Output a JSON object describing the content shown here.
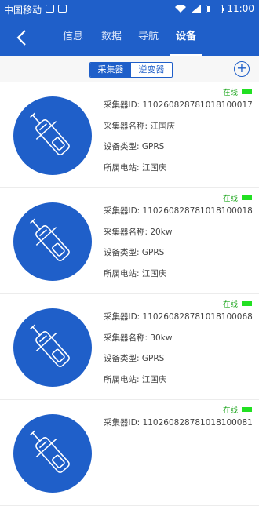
{
  "status": {
    "carrier": "中国移动",
    "time": "11:00",
    "network": "4G"
  },
  "nav": {
    "tabs": [
      {
        "label": "信息"
      },
      {
        "label": "数据"
      },
      {
        "label": "导航"
      },
      {
        "label": "设备",
        "active": true
      }
    ]
  },
  "segment": {
    "left": "采集器",
    "right": "逆变器",
    "selected": "采集器"
  },
  "colors": {
    "primary": "#1f5fc9",
    "online": "#22e022",
    "online_text": "#1aa51a"
  },
  "devices": [
    {
      "status": "在线",
      "id": "采集器ID: 110260828781018100017",
      "name": "采集器名称: 江国庆",
      "type": "设备类型: GPRS",
      "station": "所属电站: 江国庆"
    },
    {
      "status": "在线",
      "id": "采集器ID: 110260828781018100018",
      "name": "采集器名称: 20kw",
      "type": "设备类型: GPRS",
      "station": "所属电站: 江国庆"
    },
    {
      "status": "在线",
      "id": "采集器ID: 110260828781018100068",
      "name": "采集器名称: 30kw",
      "type": "设备类型: GPRS",
      "station": "所属电站: 江国庆"
    },
    {
      "status": "在线",
      "id": "采集器ID: 110260828781018100081",
      "name": "",
      "type": "",
      "station": ""
    }
  ]
}
